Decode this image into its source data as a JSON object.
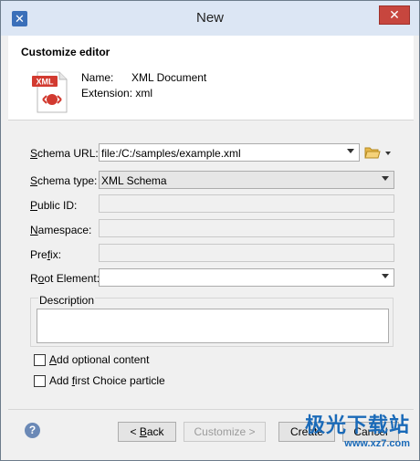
{
  "window": {
    "title": "New",
    "close_glyph": "✕"
  },
  "header": {
    "title": "Customize editor",
    "name_label": "Name:",
    "name_value": "XML Document",
    "extension_label": "Extension:",
    "extension_value": "xml",
    "icon_text": "XML",
    "icon_symbol": "<●>"
  },
  "form": {
    "schema_url": {
      "label_first": "S",
      "label_rest": "chema URL:",
      "value": "file:/C:/samples/example.xml"
    },
    "schema_type": {
      "label_first": "S",
      "label_rest": "chema type:",
      "value": "XML Schema"
    },
    "public_id": {
      "label_first": "P",
      "label_rest": "ublic ID:",
      "value": ""
    },
    "namespace": {
      "label_first": "N",
      "label_rest": "amespace:",
      "value": ""
    },
    "prefix": {
      "label_pre": "Pre",
      "label_first": "f",
      "label_rest": "ix:",
      "value": ""
    },
    "root_element": {
      "label_pre": "R",
      "label_first": "o",
      "label_rest": "ot Element:",
      "value": ""
    },
    "description": {
      "label": "Description",
      "value": ""
    }
  },
  "options": {
    "add_optional": {
      "label_first": "A",
      "label_rest": "dd optional content",
      "checked": false
    },
    "add_first_choice": {
      "label_pre": "Add ",
      "label_first": "f",
      "label_rest": "irst Choice particle",
      "checked": false
    }
  },
  "buttons": {
    "back": {
      "label_pre": "< ",
      "label_first": "B",
      "label_rest": "ack"
    },
    "customize": {
      "label": "Customize >"
    },
    "create": {
      "label": "Create"
    },
    "cancel": {
      "label": "Cancel"
    },
    "help_glyph": "?"
  },
  "watermark": {
    "text": "极光下载站",
    "url": "www.xz7.com"
  },
  "colors": {
    "accent": "#3a6fb9",
    "close": "#c7463e",
    "icon_red": "#d23a30"
  }
}
